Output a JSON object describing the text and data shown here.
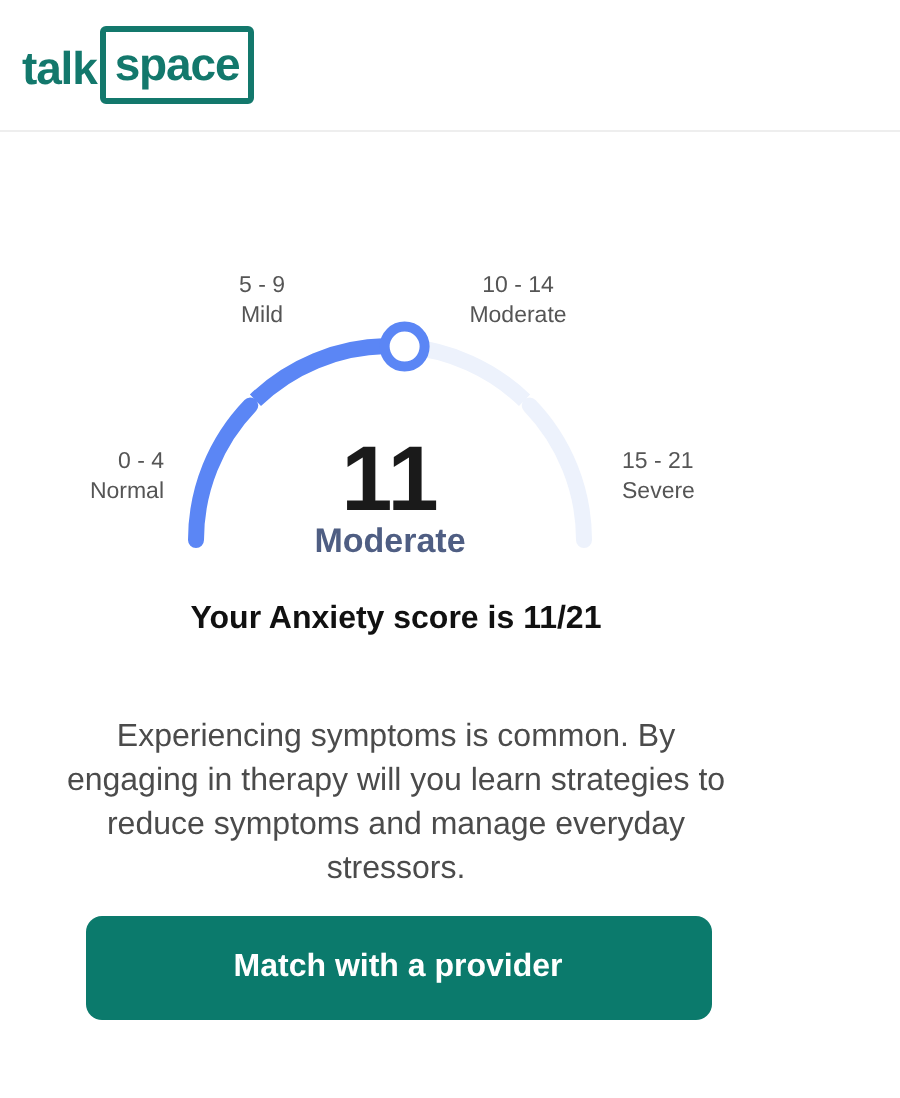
{
  "logo": {
    "prefix": "talk",
    "boxed": "space"
  },
  "gauge": {
    "score": "11",
    "severity": "Moderate",
    "segments": [
      {
        "range": "0 - 4",
        "label": "Normal"
      },
      {
        "range": "5 - 9",
        "label": "Mild"
      },
      {
        "range": "10 - 14",
        "label": "Moderate"
      },
      {
        "range": "15 - 21",
        "label": "Severe"
      }
    ]
  },
  "title": "Your Anxiety score is 11/21",
  "body": "Experiencing symptoms is common. By engaging in therapy will you learn strategies to reduce symptoms and manage everyday stressors.",
  "button": "Match with a provider"
}
